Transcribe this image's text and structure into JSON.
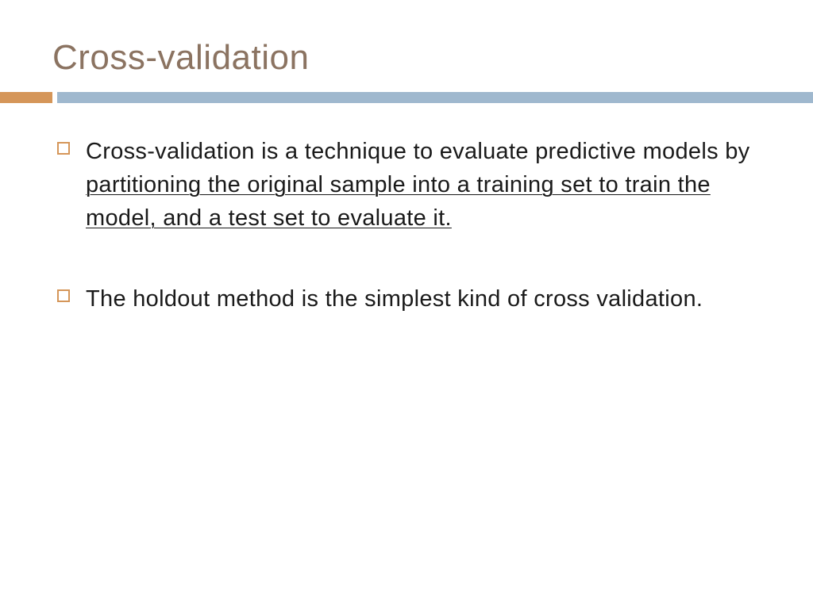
{
  "title": "Cross-validation",
  "bullets": [
    {
      "plain_before": "Cross-validation is a technique to evaluate predictive models by ",
      "underlined": "partitioning the original sample into a training set to train the model, and a test set to evaluate it.",
      "plain_after": ""
    },
    {
      "plain_before": "The holdout method is the simplest kind of cross validation.",
      "underlined": "",
      "plain_after": ""
    }
  ],
  "colors": {
    "title": "#8b7361",
    "accent_orange": "#d59659",
    "accent_blue": "#9fb8ce"
  }
}
